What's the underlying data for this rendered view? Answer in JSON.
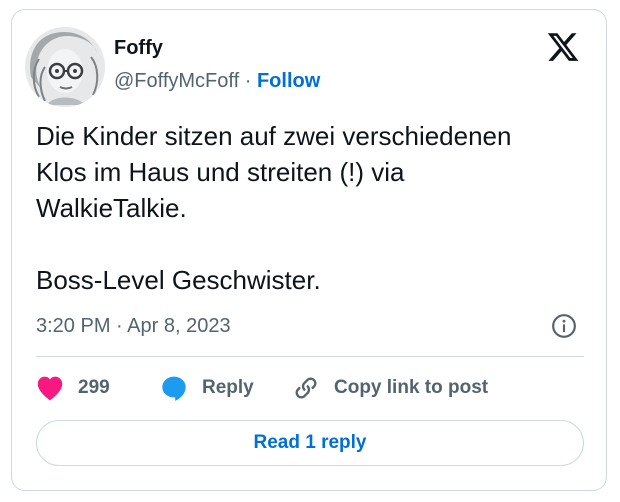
{
  "author": {
    "name": "Foffy",
    "handle": "@FoffyMcFoff",
    "separator": "·",
    "follow_label": "Follow"
  },
  "tweet": {
    "text": "Die Kinder sitzen auf zwei verschiedenen\nKlos im Haus und streiten (!) via\nWalkieTalkie.\n\nBoss-Level Geschwister.",
    "timestamp": "3:20 PM · Apr 8, 2023"
  },
  "actions": {
    "like_count": "299",
    "reply_label": "Reply",
    "copy_label": "Copy link to post"
  },
  "footer": {
    "read_replies_label": "Read 1 reply"
  },
  "colors": {
    "like": "#f91880",
    "reply": "#1d9bf0",
    "link": "#006fd6",
    "muted": "#536471",
    "border": "#cfd9de"
  },
  "icons": [
    "x-logo-icon",
    "info-icon",
    "heart-icon",
    "speech-bubble-icon",
    "link-icon"
  ]
}
